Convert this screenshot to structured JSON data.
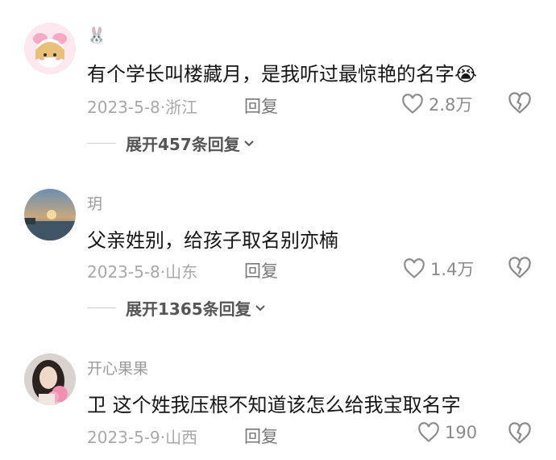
{
  "comments": [
    {
      "username": "🐰",
      "text": "有个学长叫楼藏月，是我听过最惊艳的名字😭",
      "date": "2023-5-8",
      "location": "浙江",
      "reply_label": "回复",
      "likes": "2.8万",
      "expand_label": "展开457条回复"
    },
    {
      "username": "玥",
      "text": "父亲姓别，给孩子取名别亦楠",
      "date": "2023-5-8",
      "location": "山东",
      "reply_label": "回复",
      "likes": "1.4万",
      "expand_label": "展开1365条回复"
    },
    {
      "username": "开心果果",
      "text": "卫  这个姓我压根不知道该怎么给我宝取名字",
      "date": "2023-5-9",
      "location": "山西",
      "reply_label": "回复",
      "likes": "190"
    }
  ]
}
